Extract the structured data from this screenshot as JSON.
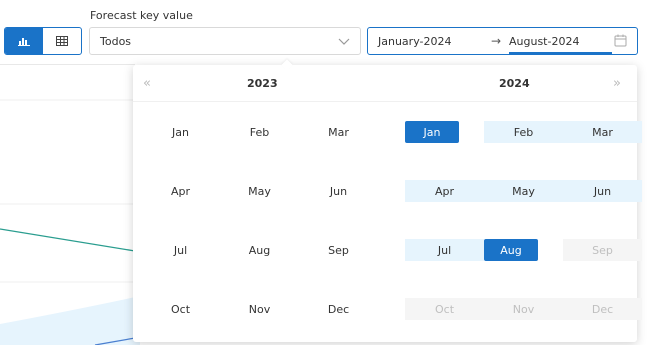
{
  "toolbar": {
    "view_chart_icon": "bar-chart-icon",
    "view_table_icon": "table-grid-icon",
    "forecast_label": "Forecast key value",
    "forecast_value": "Todos",
    "range_start": "January-2024",
    "range_arrow": "→",
    "range_end": "August-2024"
  },
  "picker": {
    "left_year": "2023",
    "right_year": "2024",
    "prev_icon": "«",
    "next_icon": "»",
    "left_months": [
      "Jan",
      "Feb",
      "Mar",
      "Apr",
      "May",
      "Jun",
      "Jul",
      "Aug",
      "Sep",
      "Oct",
      "Nov",
      "Dec"
    ],
    "right_months": [
      "Jan",
      "Feb",
      "Mar",
      "Apr",
      "May",
      "Jun",
      "Jul",
      "Aug",
      "Sep",
      "Oct",
      "Nov",
      "Dec"
    ]
  },
  "colors": {
    "accent": "#1a73c8",
    "range_bg": "#e6f4fd",
    "disabled_bg": "#f5f5f5",
    "line_green": "#2a9d8f"
  }
}
